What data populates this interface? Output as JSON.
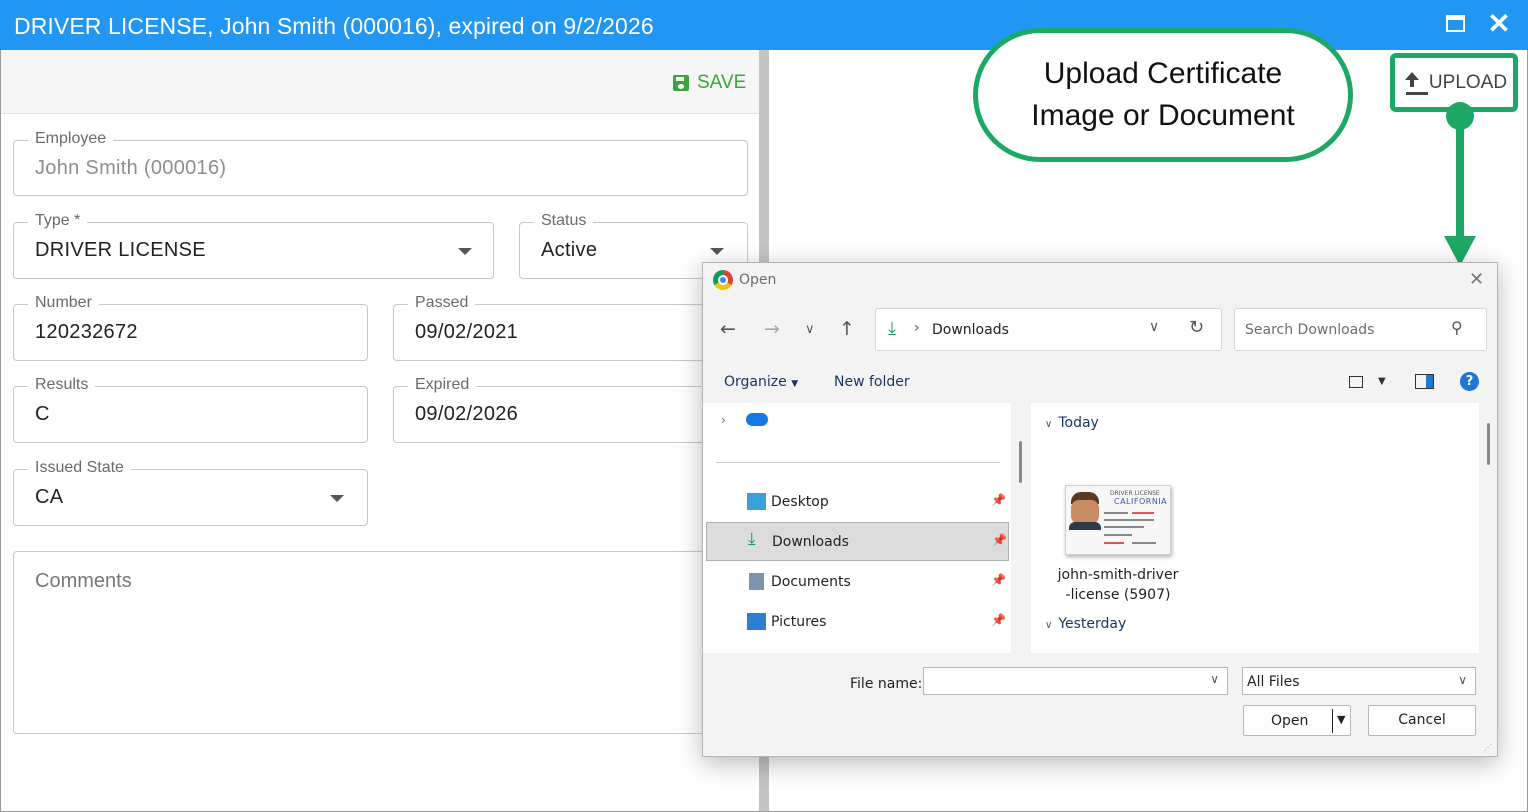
{
  "window": {
    "title": "DRIVER LICENSE, John Smith (000016), expired on 9/2/2026"
  },
  "toolbar": {
    "save_label": "SAVE",
    "upload_label": "UPLOAD"
  },
  "form": {
    "employee": {
      "label": "Employee",
      "value": "John Smith (000016)"
    },
    "type": {
      "label": "Type *",
      "value": "DRIVER LICENSE"
    },
    "status": {
      "label": "Status",
      "value": "Active"
    },
    "number": {
      "label": "Number",
      "value": "120232672"
    },
    "passed": {
      "label": "Passed",
      "value": "09/02/2021"
    },
    "results": {
      "label": "Results",
      "value": "C"
    },
    "expired": {
      "label": "Expired",
      "value": "09/02/2026"
    },
    "issued_state": {
      "label": "Issued State",
      "value": "CA"
    },
    "comments": {
      "placeholder": "Comments"
    }
  },
  "callout": {
    "line1": "Upload Certificate",
    "line2": "Image or Document"
  },
  "dialog": {
    "title": "Open",
    "path": "Downloads",
    "search_placeholder": "Search Downloads",
    "organize_label": "Organize",
    "new_folder_label": "New folder",
    "nav_items": [
      {
        "label": "Desktop",
        "icon": "desktop-icon"
      },
      {
        "label": "Downloads",
        "icon": "download-icon",
        "selected": true
      },
      {
        "label": "Documents",
        "icon": "document-icon"
      },
      {
        "label": "Pictures",
        "icon": "pictures-icon"
      }
    ],
    "groups": {
      "today": "Today",
      "yesterday": "Yesterday"
    },
    "file": {
      "name_line1": "john-smith-driver",
      "name_line2": "-license (5907)",
      "thumb_header": "DRIVER LICENSE",
      "thumb_state": "CALIFORNIA"
    },
    "file_name_label": "File name:",
    "file_name_value": "",
    "filter_value": "All Files",
    "open_label": "Open",
    "cancel_label": "Cancel"
  },
  "colors": {
    "titlebar": "#2196F3",
    "save": "#3ca53c",
    "callout_accent": "#1da865",
    "selection": "#dcdcdc"
  }
}
